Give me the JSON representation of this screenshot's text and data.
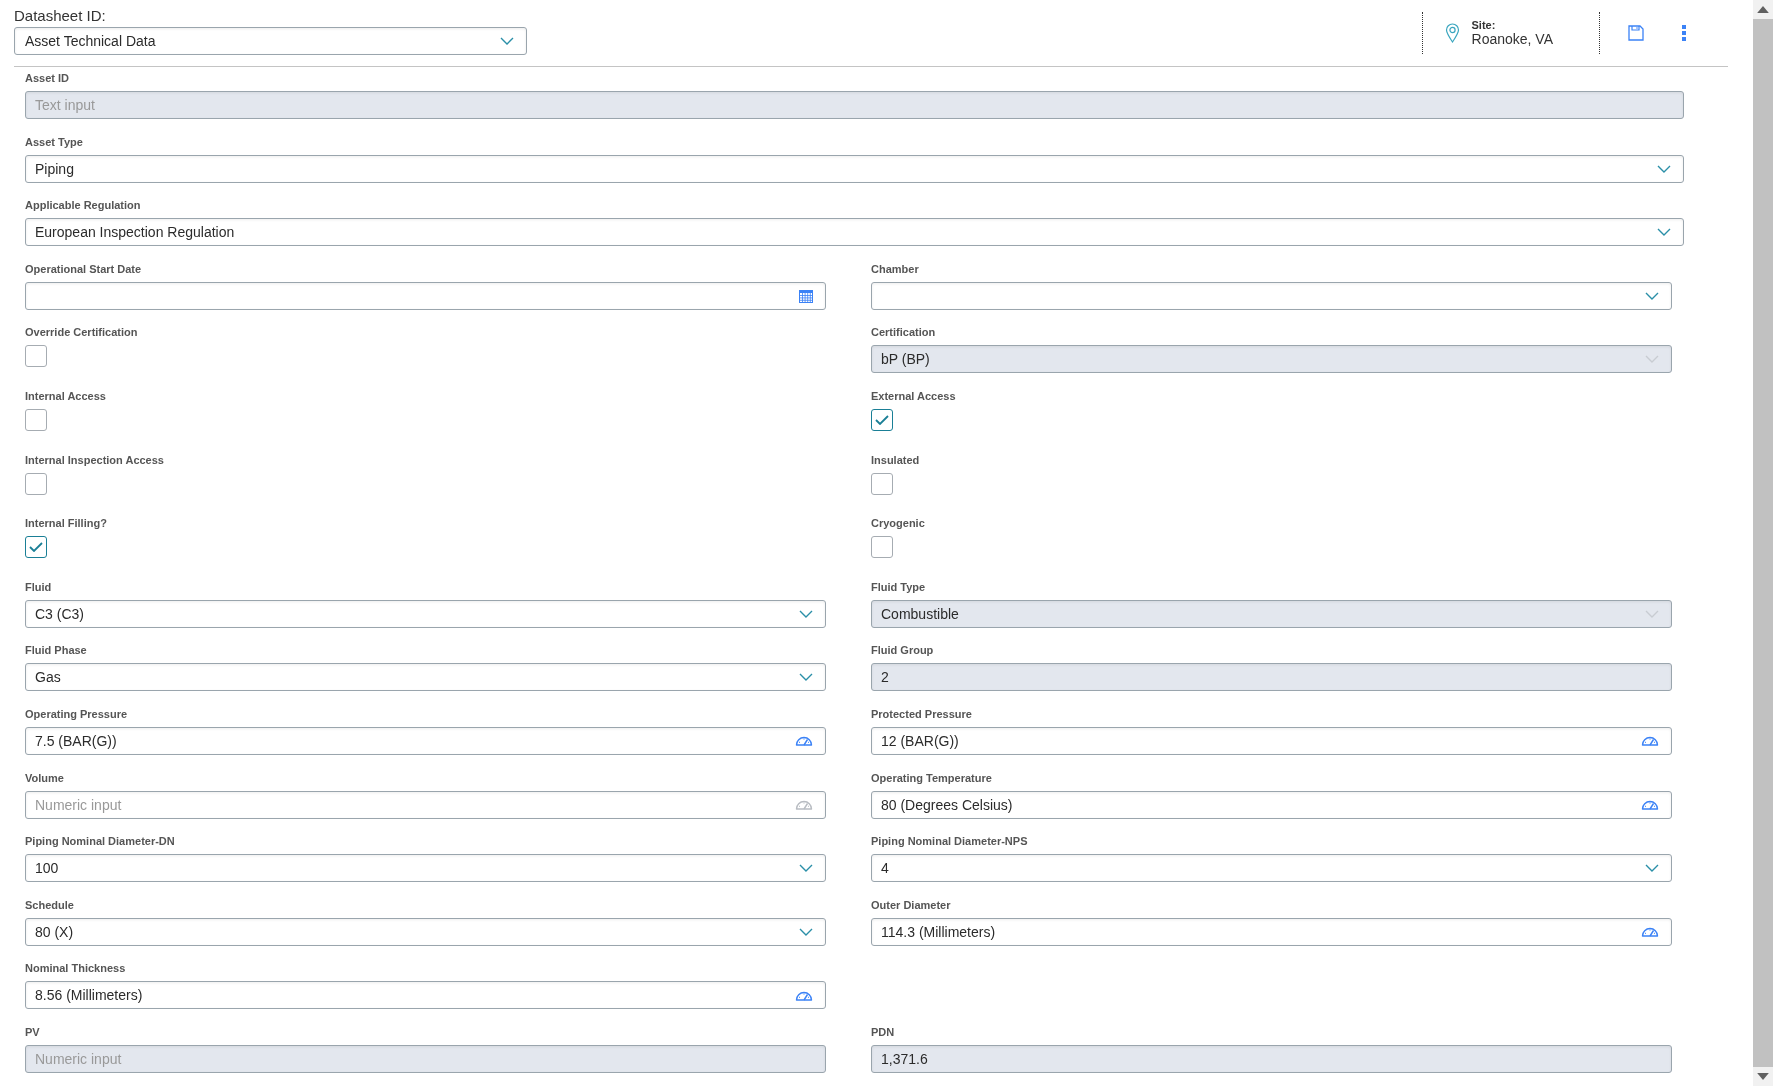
{
  "header": {
    "datasheet_label": "Datasheet ID:",
    "datasheet": {
      "value": "Asset Technical Data"
    },
    "site_label": "Site:",
    "site_value": "Roanoke, VA"
  },
  "wide_fields": [
    {
      "label": "Asset ID",
      "kind": "text",
      "placeholder": "Text input",
      "disabled": true
    },
    {
      "label": "Asset Type",
      "kind": "dropdown",
      "value": "Piping",
      "disabled": false
    },
    {
      "label": "Applicable Regulation",
      "kind": "dropdown",
      "value": "European Inspection Regulation",
      "disabled": false
    }
  ],
  "rows": [
    {
      "left": {
        "label": "Operational Start Date",
        "kind": "date",
        "disabled": false
      },
      "right": {
        "label": "Chamber",
        "kind": "dropdown",
        "disabled": false
      }
    },
    {
      "left": {
        "label": "Override Certification",
        "kind": "checkbox",
        "checked": false
      },
      "right": {
        "label": "Certification",
        "kind": "dropdown",
        "value": "bP (BP)",
        "disabled": true
      }
    },
    {
      "left": {
        "label": "Internal Access",
        "kind": "checkbox",
        "checked": false
      },
      "right": {
        "label": "External Access",
        "kind": "checkbox",
        "checked": true
      }
    },
    {
      "left": {
        "label": "Internal Inspection Access",
        "kind": "checkbox",
        "checked": false
      },
      "right": {
        "label": "Insulated",
        "kind": "checkbox",
        "checked": false
      }
    },
    {
      "left": {
        "label": "Internal Filling?",
        "kind": "checkbox",
        "checked": true
      },
      "right": {
        "label": "Cryogenic",
        "kind": "checkbox",
        "checked": false
      }
    },
    {
      "left": {
        "label": "Fluid",
        "kind": "dropdown",
        "value": "C3 (C3)",
        "disabled": false
      },
      "right": {
        "label": "Fluid Type",
        "kind": "dropdown",
        "value": "Combustible",
        "disabled": true
      }
    },
    {
      "left": {
        "label": "Fluid Phase",
        "kind": "dropdown",
        "value": "Gas",
        "disabled": false
      },
      "right": {
        "label": "Fluid Group",
        "kind": "text",
        "value": "2",
        "disabled": true
      }
    },
    {
      "left": {
        "label": "Operating Pressure",
        "kind": "measure",
        "value": "7.5 (BAR(G))",
        "disabled": false
      },
      "right": {
        "label": "Protected Pressure",
        "kind": "measure",
        "value": "12 (BAR(G))",
        "disabled": false
      }
    },
    {
      "left": {
        "label": "Volume",
        "kind": "measure",
        "placeholder": "Numeric input",
        "disabled": false
      },
      "right": {
        "label": "Operating Temperature",
        "kind": "measure",
        "value": "80 (Degrees Celsius)",
        "disabled": false
      }
    },
    {
      "left": {
        "label": "Piping Nominal Diameter-DN",
        "kind": "dropdown",
        "value": "100",
        "disabled": false
      },
      "right": {
        "label": "Piping Nominal Diameter-NPS",
        "kind": "dropdown",
        "value": "4",
        "disabled": false
      }
    },
    {
      "left": {
        "label": "Schedule",
        "kind": "dropdown",
        "value": "80 (X)",
        "disabled": false
      },
      "right": {
        "label": "Outer Diameter",
        "kind": "measure",
        "value": "114.3 (Millimeters)",
        "disabled": false
      }
    },
    {
      "left": {
        "label": "Nominal Thickness",
        "kind": "measure",
        "value": "8.56 (Millimeters)",
        "disabled": false
      }
    },
    {
      "left": {
        "label": "PV",
        "kind": "text",
        "placeholder": "Numeric input",
        "disabled": true
      },
      "right": {
        "label": "PDN",
        "kind": "text",
        "value": "1,371.6",
        "disabled": true
      }
    }
  ]
}
